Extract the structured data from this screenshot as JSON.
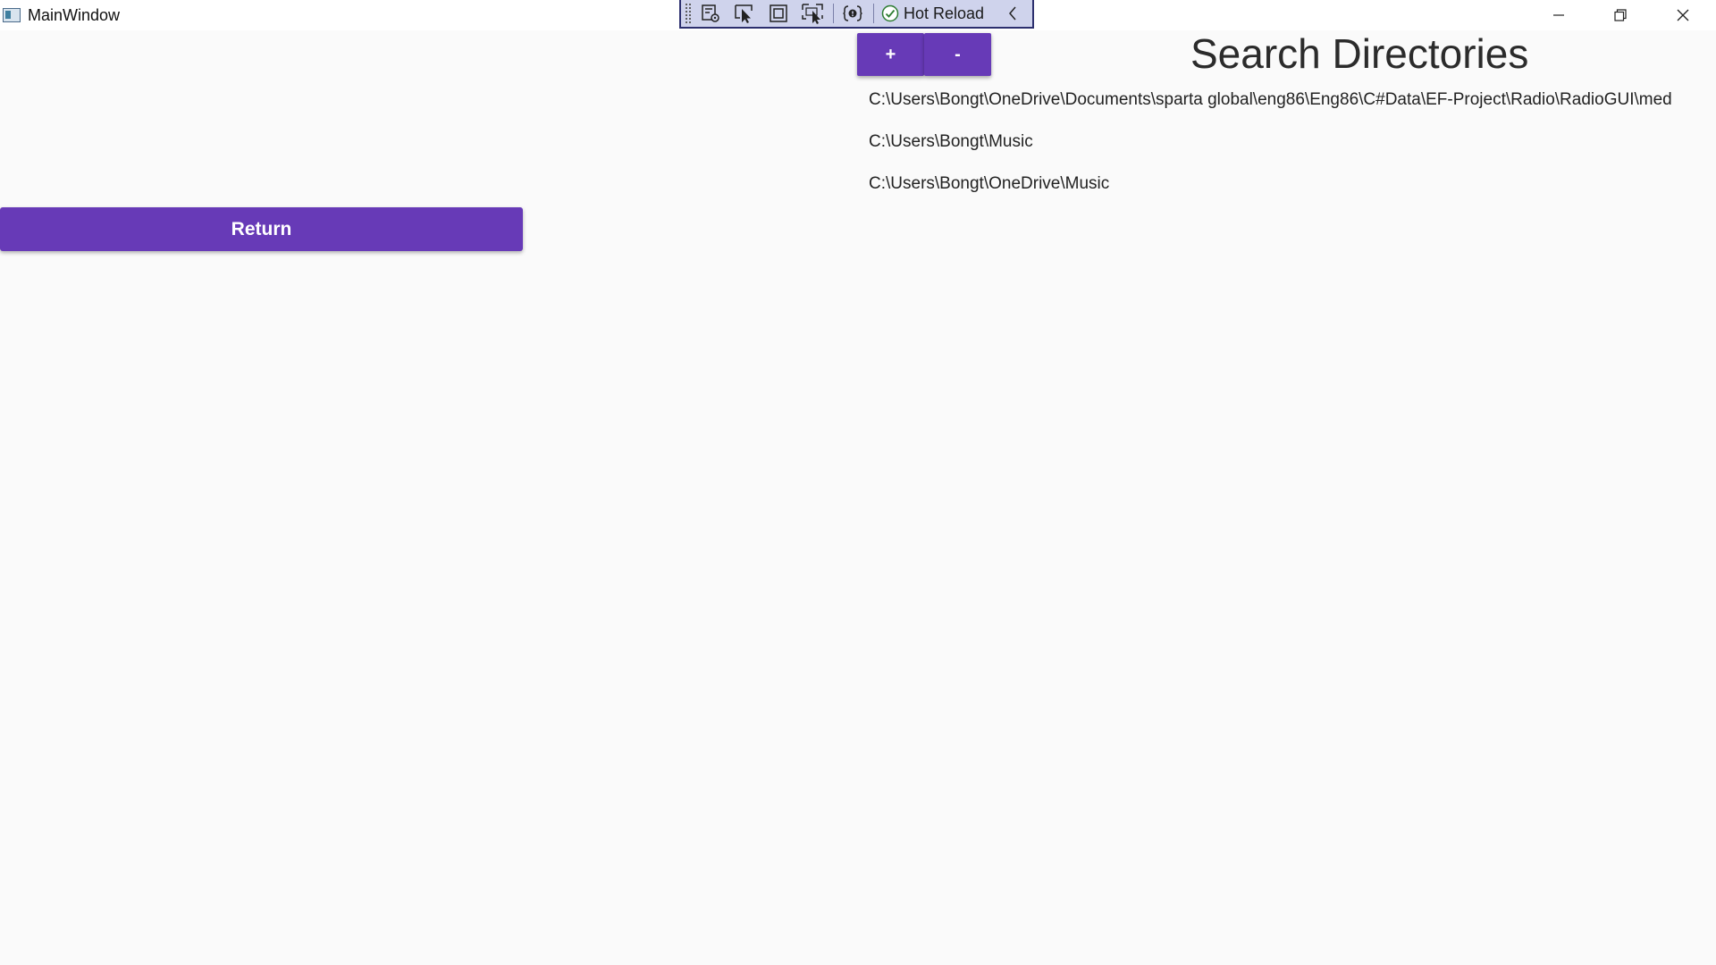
{
  "window": {
    "title": "MainWindow",
    "controls": [
      "minimize-icon",
      "restore-icon",
      "close-icon"
    ]
  },
  "debug_toolbar": {
    "icons": [
      "live-visual-tree-icon",
      "select-element-icon",
      "display-layout-adorners-icon",
      "track-focus-icon",
      "binding-failures-icon"
    ],
    "hot_reload_label": "Hot Reload",
    "hot_reload_status_icon": "check-circle-icon",
    "collapse_icon": "chevron-left-icon"
  },
  "main": {
    "return_label": "Return",
    "add_label": "+",
    "remove_label": "-",
    "title": "Search Directories",
    "directories": [
      "C:\\Users\\Bongt\\OneDrive\\Documents\\sparta global\\eng86\\Eng86\\C#Data\\EF-Project\\Radio\\RadioGUI\\med",
      "C:\\Users\\Bongt\\Music",
      "C:\\Users\\Bongt\\OneDrive\\Music"
    ]
  },
  "colors": {
    "accent": "#673ab7",
    "background": "#fafafa",
    "toolbar_bg": "#cfd3ec",
    "toolbar_border": "#2c2f6e"
  }
}
